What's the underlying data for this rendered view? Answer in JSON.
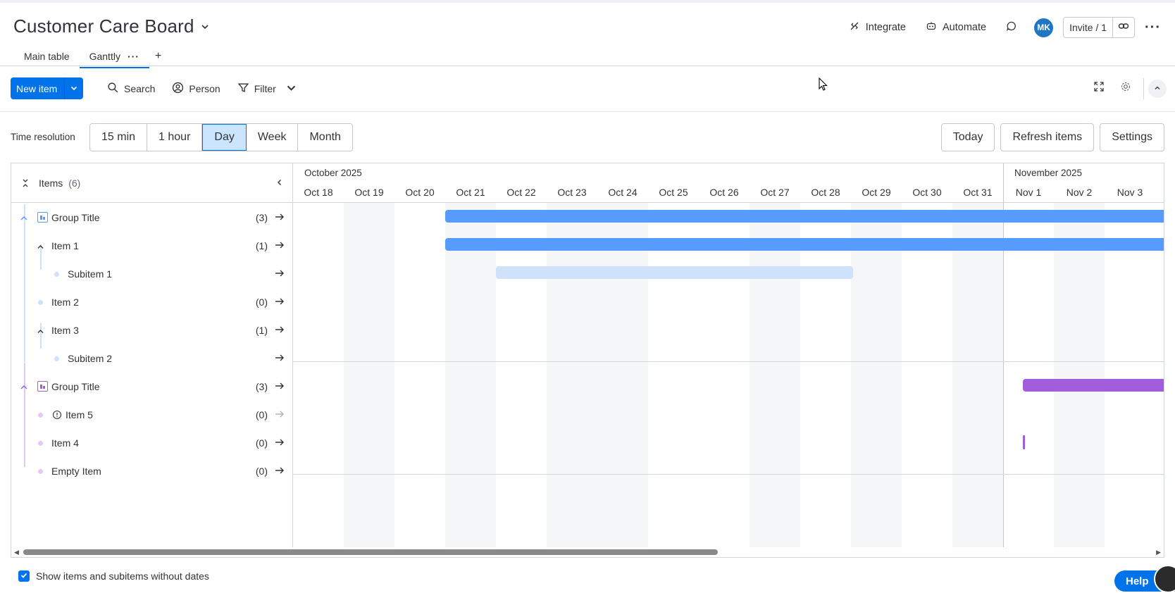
{
  "board": {
    "title": "Customer Care Board"
  },
  "header": {
    "integrate": "Integrate",
    "automate": "Automate",
    "avatar_initials": "MK",
    "invite": "Invite / 1"
  },
  "tabs": [
    {
      "label": "Main table"
    },
    {
      "label": "Ganttly"
    }
  ],
  "toolbar": {
    "new_item": "New item",
    "search": "Search",
    "person": "Person",
    "filter": "Filter"
  },
  "resolution": {
    "label": "Time resolution",
    "options": [
      "15 min",
      "1 hour",
      "Day",
      "Week",
      "Month"
    ],
    "selected": "Day",
    "today": "Today",
    "refresh": "Refresh items",
    "settings": "Settings"
  },
  "items_panel": {
    "title": "Items",
    "count": "(6)",
    "rows": [
      {
        "label": "Group Title",
        "count": "(3)"
      },
      {
        "label": "Item 1",
        "count": "(1)"
      },
      {
        "label": "Subitem 1",
        "count": ""
      },
      {
        "label": "Item 2",
        "count": "(0)"
      },
      {
        "label": "Item 3",
        "count": "(1)"
      },
      {
        "label": "Subitem 2",
        "count": ""
      },
      {
        "label": "Group Title",
        "count": "(3)"
      },
      {
        "label": "Item 5",
        "count": "(0)"
      },
      {
        "label": "Item 4",
        "count": "(0)"
      },
      {
        "label": "Empty Item",
        "count": "(0)"
      }
    ]
  },
  "timeline": {
    "months": [
      "October 2025",
      "November 2025"
    ],
    "days": [
      "Oct 18",
      "Oct 19",
      "Oct 20",
      "Oct 21",
      "Oct 22",
      "Oct 23",
      "Oct 24",
      "Oct 25",
      "Oct 26",
      "Oct 27",
      "Oct 28",
      "Oct 29",
      "Oct 30",
      "Oct 31",
      "Nov 1",
      "Nov 2",
      "Nov 3"
    ]
  },
  "colors": {
    "group1": "#579bfc",
    "group1_light": "#cfe1fb",
    "group2": "#a25ddc",
    "group2_light": "#e3c9f3",
    "primary": "#0073ea"
  },
  "footer": {
    "show_without_dates": "Show items and subitems without dates"
  },
  "help": {
    "label": "Help"
  }
}
